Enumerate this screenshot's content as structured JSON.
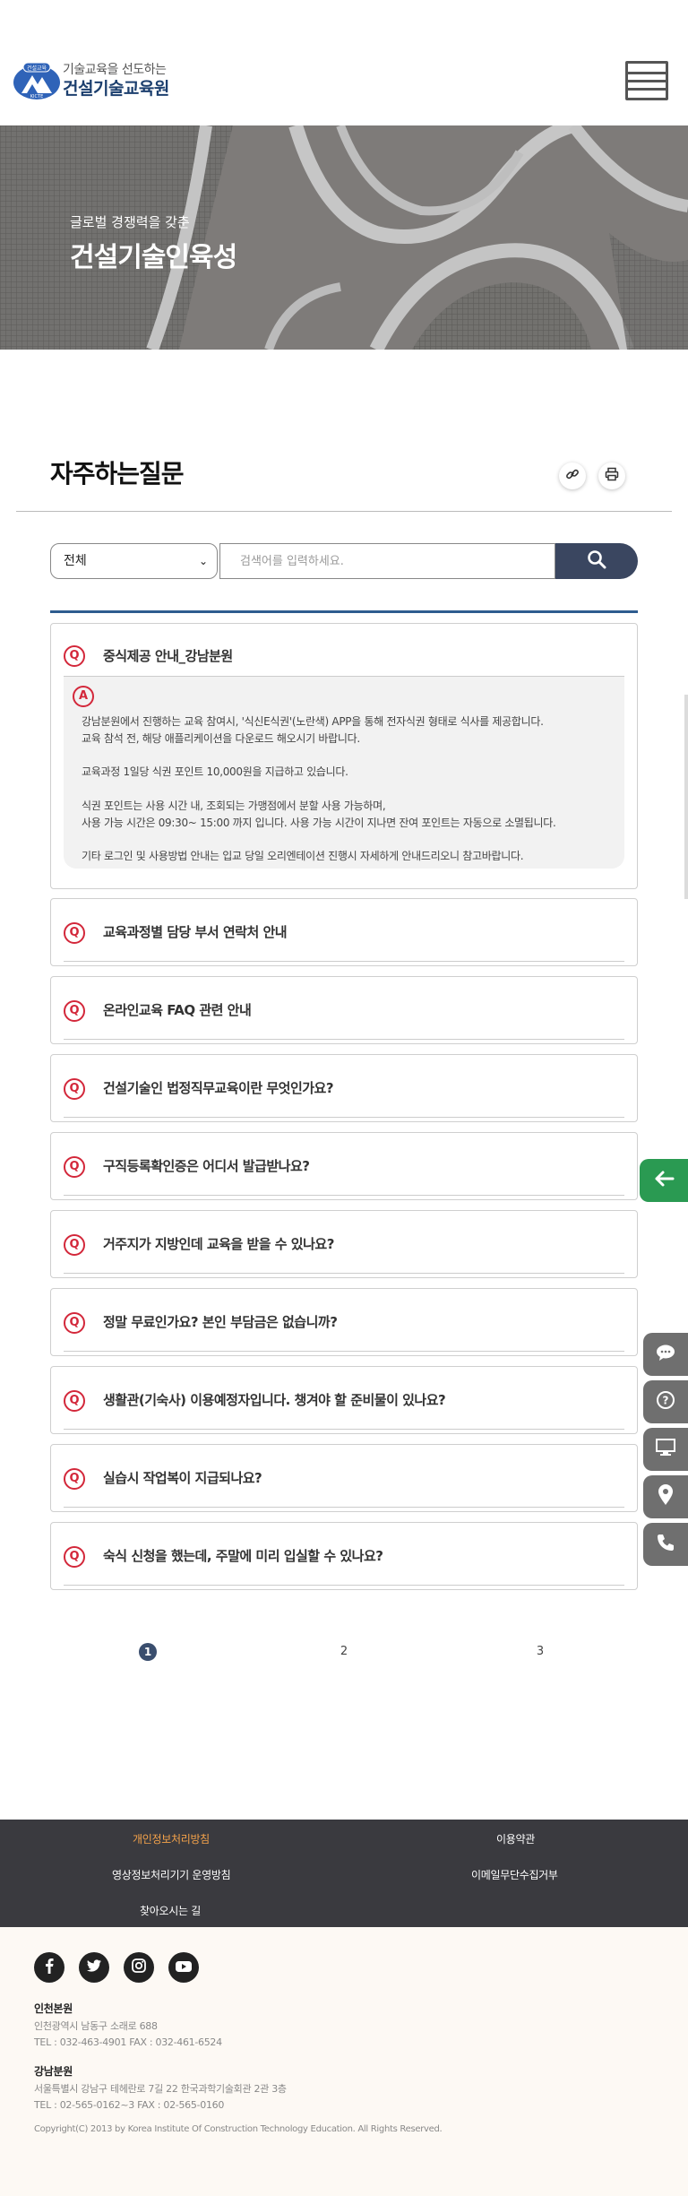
{
  "header": {
    "logo_badge": "건설교육",
    "logo_abbr": "KICTE",
    "logo_sub": "기술교육을 선도하는",
    "logo_main": "건설기술교육원"
  },
  "hero": {
    "subtitle": "글로벌 경쟁력을 갖춘",
    "title": "건설기술인육성"
  },
  "page": {
    "title": "자주하는질문"
  },
  "search": {
    "category": "전체",
    "placeholder": "검색어를 입력하세요."
  },
  "faq": [
    {
      "q_mark": "Q",
      "question": "중식제공 안내_강남분원",
      "expanded": true,
      "a_mark": "A",
      "answer_lines": [
        "강남분원에서 진행하는 교육 참여시, '식신E식권'(노란색) APP을 통해 전자식권 형태로 식사를 제공합니다.",
        "교육 참석 전, 해당 애플리케이션을 다운로드 해오시기 바랍니다.",
        "",
        "교육과정 1일당 식권 포인트 10,000원을 지급하고 있습니다.",
        "",
        "식권 포인트는 사용 시간 내, 조회되는 가맹점에서 분할 사용 가능하며,",
        "사용 가능 시간은 09:30~ 15:00 까지 입니다. 사용 가능 시간이 지나면 잔여 포인트는 자동으로 소멸됩니다.",
        "",
        "기타 로그인 및 사용방법 안내는 입교 당일 오리엔테이션 진행시 자세하게 안내드리오니 참고바랍니다."
      ]
    },
    {
      "q_mark": "Q",
      "question": "교육과정별 담당 부서 연락처 안내"
    },
    {
      "q_mark": "Q",
      "question": "온라인교육 FAQ 관련 안내"
    },
    {
      "q_mark": "Q",
      "question": "건설기술인 법정직무교육이란 무엇인가요?"
    },
    {
      "q_mark": "Q",
      "question": "구직등록확인증은 어디서 발급받나요?"
    },
    {
      "q_mark": "Q",
      "question": "거주지가 지방인데 교육을 받을 수 있나요?"
    },
    {
      "q_mark": "Q",
      "question": "정말 무료인가요? 본인 부담금은 없습니까?"
    },
    {
      "q_mark": "Q",
      "question": "생활관(기숙사) 이용예정자입니다. 챙겨야 할 준비물이 있나요?"
    },
    {
      "q_mark": "Q",
      "question": "실습시 작업복이 지급되나요?"
    },
    {
      "q_mark": "Q",
      "question": "숙식 신청을 했는데, 주말에 미리 입실할 수 있나요?"
    }
  ],
  "pagination": {
    "pages": [
      "1",
      "2",
      "3"
    ],
    "current": "1"
  },
  "side_buttons": [
    "arrow-left-icon",
    "chat-icon",
    "question-icon",
    "monitor-icon",
    "location-pin-icon",
    "phone-icon"
  ],
  "footer": {
    "links": [
      "개인정보처리방침",
      "이용약관",
      "영상정보처리기기 운영방침",
      "이메일무단수집거부",
      "찾아오시는 길"
    ],
    "highlight_color": "#f5a34a",
    "sns": [
      "facebook-icon",
      "twitter-icon",
      "instagram-icon",
      "youtube-icon"
    ],
    "branch1_name": "인천본원",
    "branch1_addr": "인천광역시 남동구 소래로 688",
    "branch1_tel": "TEL : 032-463-4901   FAX : 032-461-6524",
    "branch2_name": "강남분원",
    "branch2_addr": "서울특별시 강남구 테헤란로 7길 22 한국과학기술회관 2관 3층",
    "branch2_tel": "TEL : 02-565-0162~3   FAX : 02-565-0160",
    "copyright": "Copyright(C) 2013 by Korea Institute Of Construction Technology Education. All Rights Reserved."
  },
  "colors": {
    "accent": "#2e5c8f",
    "q_mark": "#d3273a",
    "search_button": "#3a4660",
    "side_green": "#2a9a52"
  }
}
